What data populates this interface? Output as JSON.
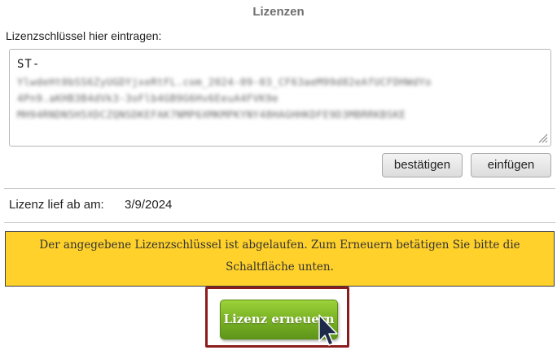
{
  "panel": {
    "title": "Lizenzen"
  },
  "license_key": {
    "label": "Lizenzschlüssel hier eintragen:",
    "prefix": "ST-",
    "redacted_lines": [
      "YlwdeHt0bSS6ZyUGDYjxeRtFL.com_2024-09-03_CF63aeM99d82eAfUCFDHWdYo",
      "4Pn9.aKHB3B4dVk3-3oFlb4GB9G6Hv6EeuA4FVK9e",
      "MH94RNDN5H5XDCZQNSDKEFAK7NMP6XMKMPKYNY48HAGHHKDFE9D3MBRRKBSKE"
    ],
    "redacted": true
  },
  "buttons": {
    "confirm": "bestätigen",
    "paste": "einfügen",
    "renew": "Lizenz erneuern"
  },
  "expiry": {
    "label": "Lizenz lief ab am:",
    "date": "3/9/2024"
  },
  "notice": {
    "line1": "Der angegebene Lizenzschlüssel ist abgelaufen. Zum Erneuern betätigen Sie bitte die",
    "line2": "Schaltfläche unten."
  },
  "colors": {
    "notice_bg": "#ffd12a",
    "renew_button": "#7db526",
    "highlight_frame": "#8b1c1c"
  },
  "icons": {
    "resize": "resize-grip-icon",
    "cursor": "mouse-pointer-icon"
  }
}
